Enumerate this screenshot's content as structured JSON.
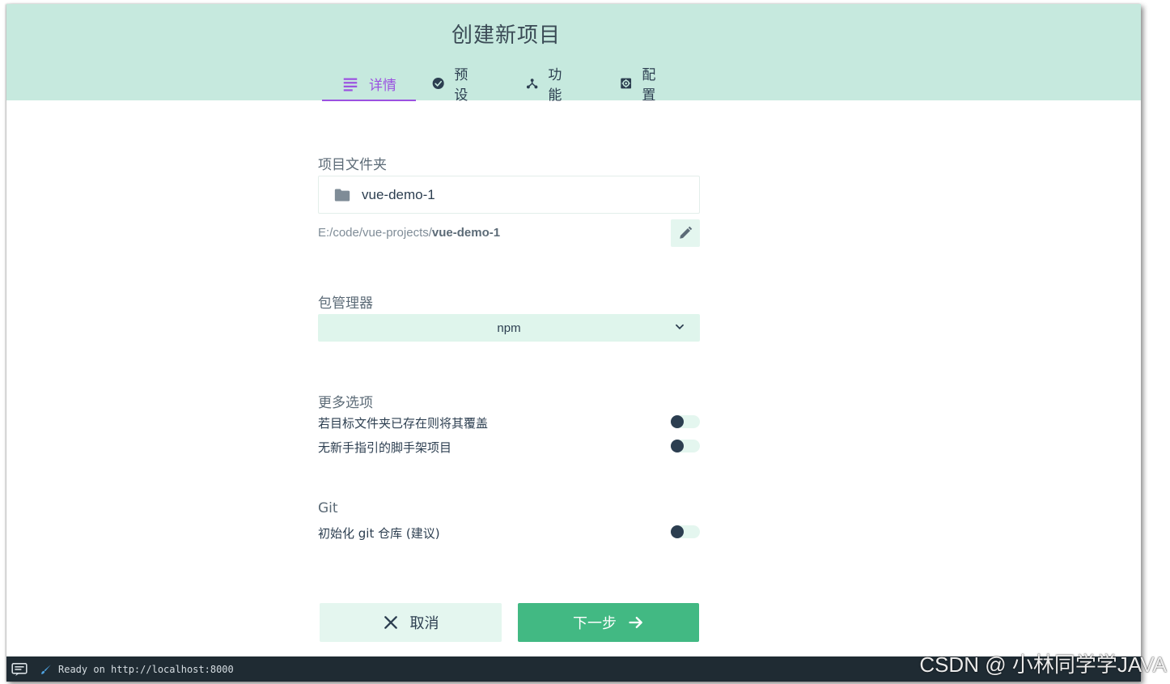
{
  "header": {
    "title": "创建新项目",
    "tabs": [
      {
        "label": "详情",
        "icon": "list-icon",
        "active": true
      },
      {
        "label": "预设",
        "icon": "check-circle-icon",
        "active": false
      },
      {
        "label": "功能",
        "icon": "fork-icon",
        "active": false
      },
      {
        "label": "配置",
        "icon": "gear-icon",
        "active": false
      }
    ]
  },
  "folder": {
    "label": "项目文件夹",
    "value": "vue-demo-1",
    "path_prefix": "E:/code/vue-projects/",
    "path_name": "vue-demo-1"
  },
  "package_manager": {
    "label": "包管理器",
    "selected": "npm"
  },
  "more_options": {
    "label": "更多选项",
    "items": [
      {
        "label": "若目标文件夹已存在则将其覆盖",
        "enabled": false
      },
      {
        "label": "无新手指引的脚手架项目",
        "enabled": false
      }
    ]
  },
  "git": {
    "label": "Git",
    "items": [
      {
        "label": "初始化 git 仓库 (建议)",
        "enabled": false
      }
    ]
  },
  "actions": {
    "cancel_label": "取消",
    "next_label": "下一步"
  },
  "statusbar": {
    "text": "Ready on http://localhost:8000"
  },
  "watermark": "CSDN @ 小林同学学JAVA",
  "colors": {
    "header_bg": "#c6e9de",
    "accent": "#42b983",
    "active_tab": "#9b51e0",
    "statusbar_bg": "#1f2b33"
  }
}
